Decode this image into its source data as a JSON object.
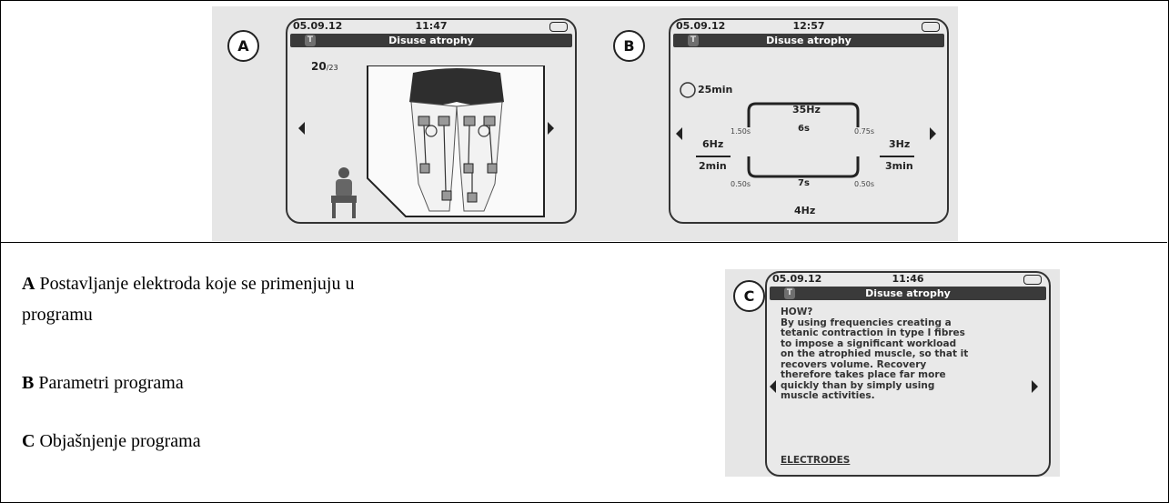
{
  "screens": {
    "A": {
      "badge": "A",
      "date": "05.09.12",
      "time": "11:47",
      "title": "Disuse atrophy",
      "counter_current": "20",
      "counter_total": "/23"
    },
    "B": {
      "badge": "B",
      "date": "05.09.12",
      "time": "12:57",
      "title": "Disuse atrophy",
      "total_time": "25min",
      "top_freq": "35Hz",
      "on_time": "6s",
      "ramp_up_left": "1.50s",
      "ramp_up_right": "0.75s",
      "warmup_freq": "6Hz",
      "warmup_time": "2min",
      "cooldown_freq": "3Hz",
      "cooldown_time": "3min",
      "ramp_down_left": "0.50s",
      "ramp_down_right": "0.50s",
      "off_time": "7s",
      "bottom_freq": "4Hz"
    },
    "C": {
      "badge": "C",
      "date": "05.09.12",
      "time": "11:46",
      "title": "Disuse atrophy",
      "text_lines": [
        "HOW?",
        "By using frequencies creating a",
        "tetanic contraction in type I fibres",
        "to impose a significant workload",
        "on the atrophied muscle, so that it",
        "recovers volume. Recovery",
        "therefore takes place far more",
        "quickly than by simply using",
        "muscle activities."
      ],
      "footer": "ELECTRODES"
    }
  },
  "captions": {
    "a_letter": "A",
    "a_text": " Postavljanje elektroda koje se primenjuju u",
    "a_text_cont": "programu",
    "b_letter": "B",
    "b_text": " Parametri programa",
    "c_letter": "C",
    "c_text": " Objašnjenje programa"
  }
}
